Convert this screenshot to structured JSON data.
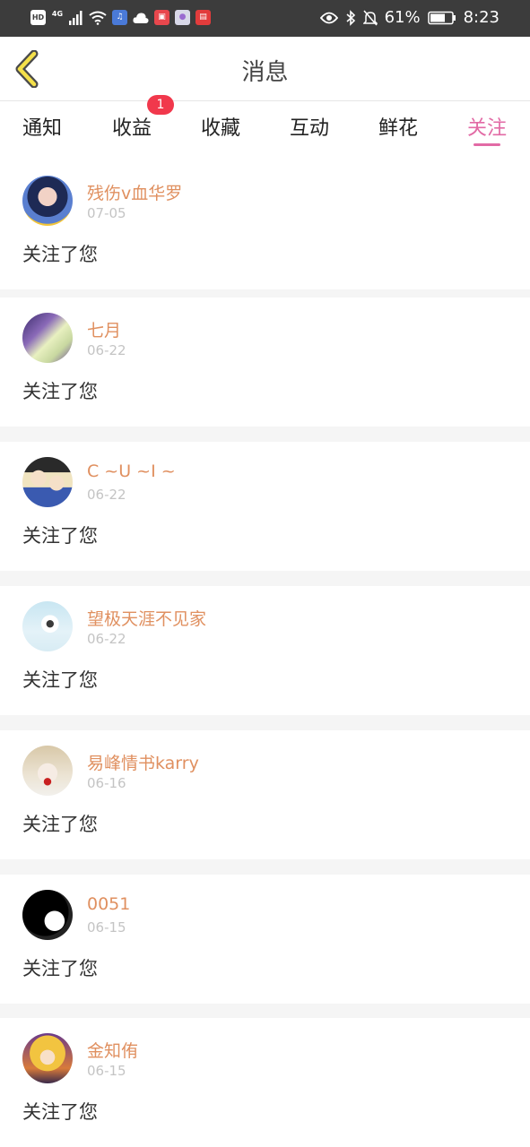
{
  "status": {
    "hd": "HD",
    "network": "4G",
    "battery_pct": "61%",
    "time": "8:23",
    "icons": [
      "signal-icon",
      "wifi-icon",
      "music-app-icon",
      "cloud-icon",
      "red-app-icon",
      "gallery-app-icon",
      "shop-app-icon",
      "eye-icon",
      "bluetooth-icon",
      "bell-off-icon",
      "battery-icon"
    ]
  },
  "header": {
    "title": "消息",
    "back_icon": "chevron-left-icon"
  },
  "tabs": [
    {
      "label": "通知"
    },
    {
      "label": "收益",
      "badge": "1"
    },
    {
      "label": "收藏"
    },
    {
      "label": "互动"
    },
    {
      "label": "鲜花"
    },
    {
      "label": "关注",
      "active": true
    }
  ],
  "accent_color": "#e26aa5",
  "name_color": "#e09060",
  "follows": [
    {
      "name": "残伤v血华罗",
      "date": "07-05",
      "message": "关注了您"
    },
    {
      "name": "七月",
      "date": "06-22",
      "message": "关注了您"
    },
    {
      "name": "C ~U ~I ~",
      "date": "06-22",
      "message": "关注了您"
    },
    {
      "name": "望极天涯不见家",
      "date": "06-22",
      "message": "关注了您"
    },
    {
      "name": "易峰情书karry",
      "date": "06-16",
      "message": "关注了您"
    },
    {
      "name": "0051",
      "date": "06-15",
      "message": "关注了您"
    },
    {
      "name": "金知侑",
      "date": "06-15",
      "message": "关注了您"
    }
  ]
}
